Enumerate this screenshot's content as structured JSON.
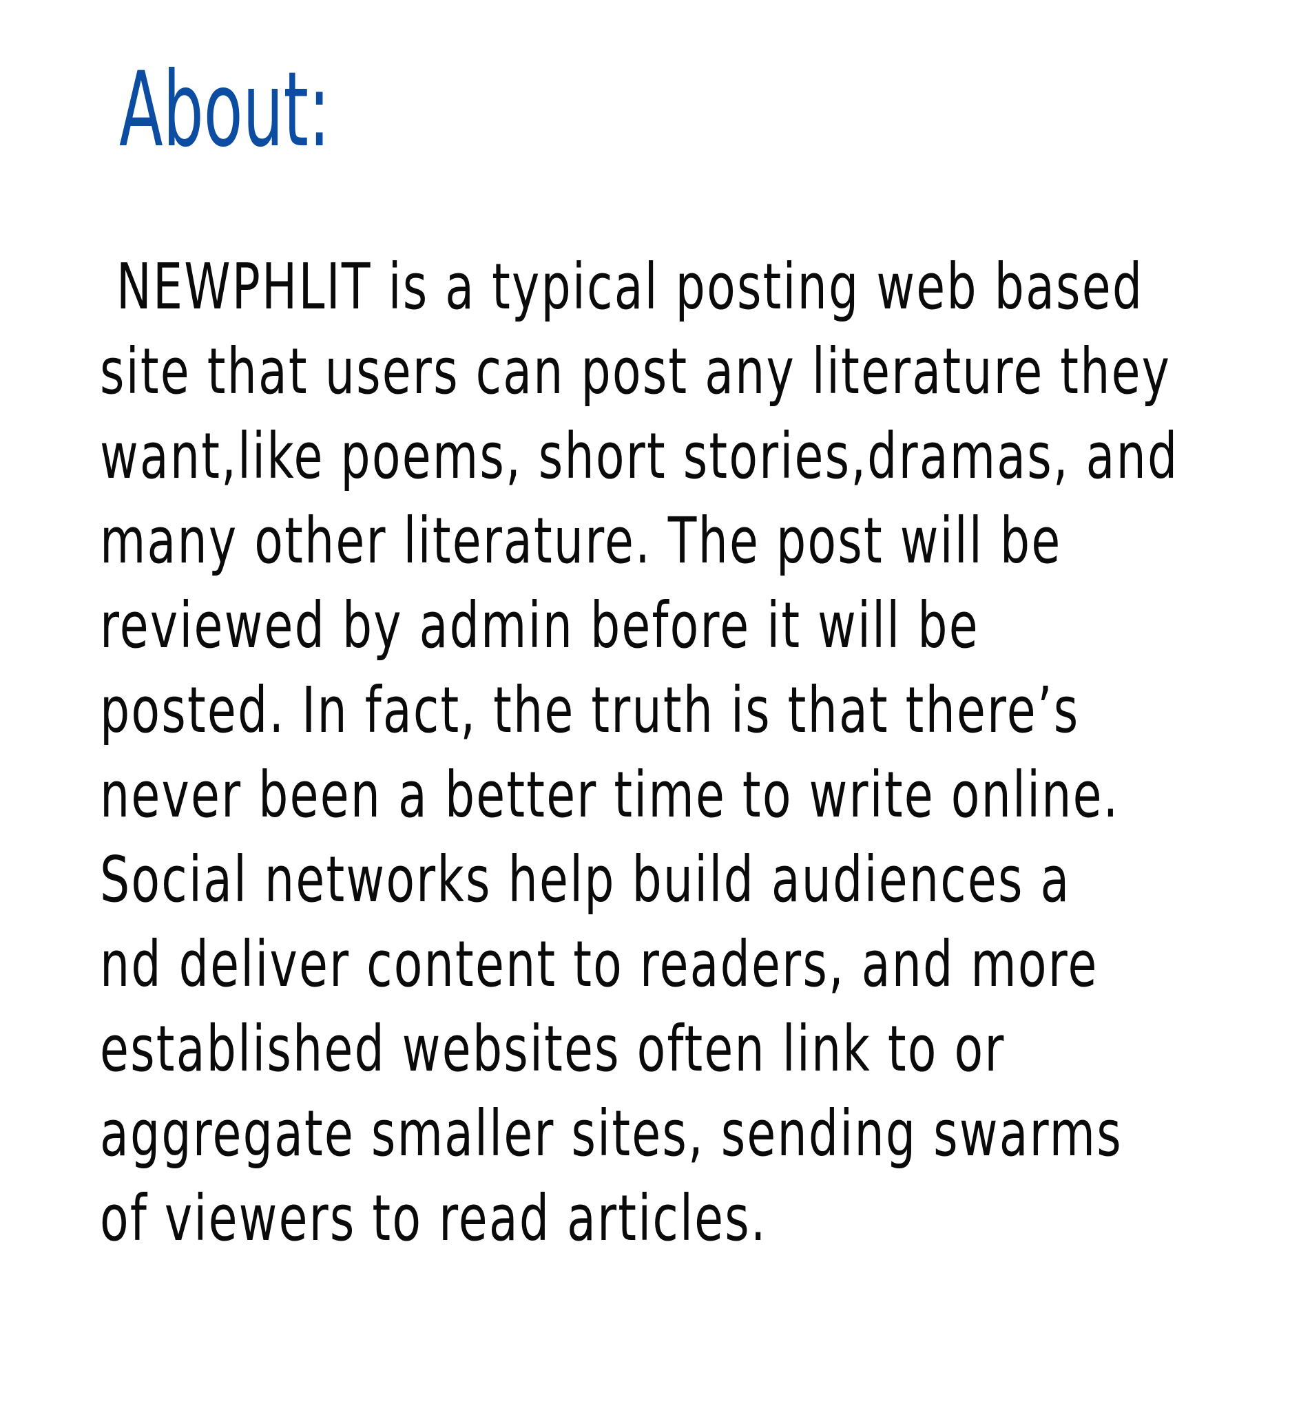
{
  "heading": "About:",
  "body_lines": [
    " NEWPHLIT is a typical posting web based",
    "site that users can post any literature they",
    "want,like poems, short stories,dramas, and",
    "many other literature. The post will be",
    "reviewed by admin before it will be",
    "posted. In fact, the truth is that there’s",
    "never been a better time to write online.",
    "Social networks help build audiences a",
    "nd deliver content to readers, and more",
    "established websites often link to or",
    "aggregate smaller sites, sending swarms",
    "of viewers to read articles."
  ],
  "colors": {
    "heading": "#0c4da2",
    "text": "#0a0a0a",
    "background": "#ffffff"
  }
}
